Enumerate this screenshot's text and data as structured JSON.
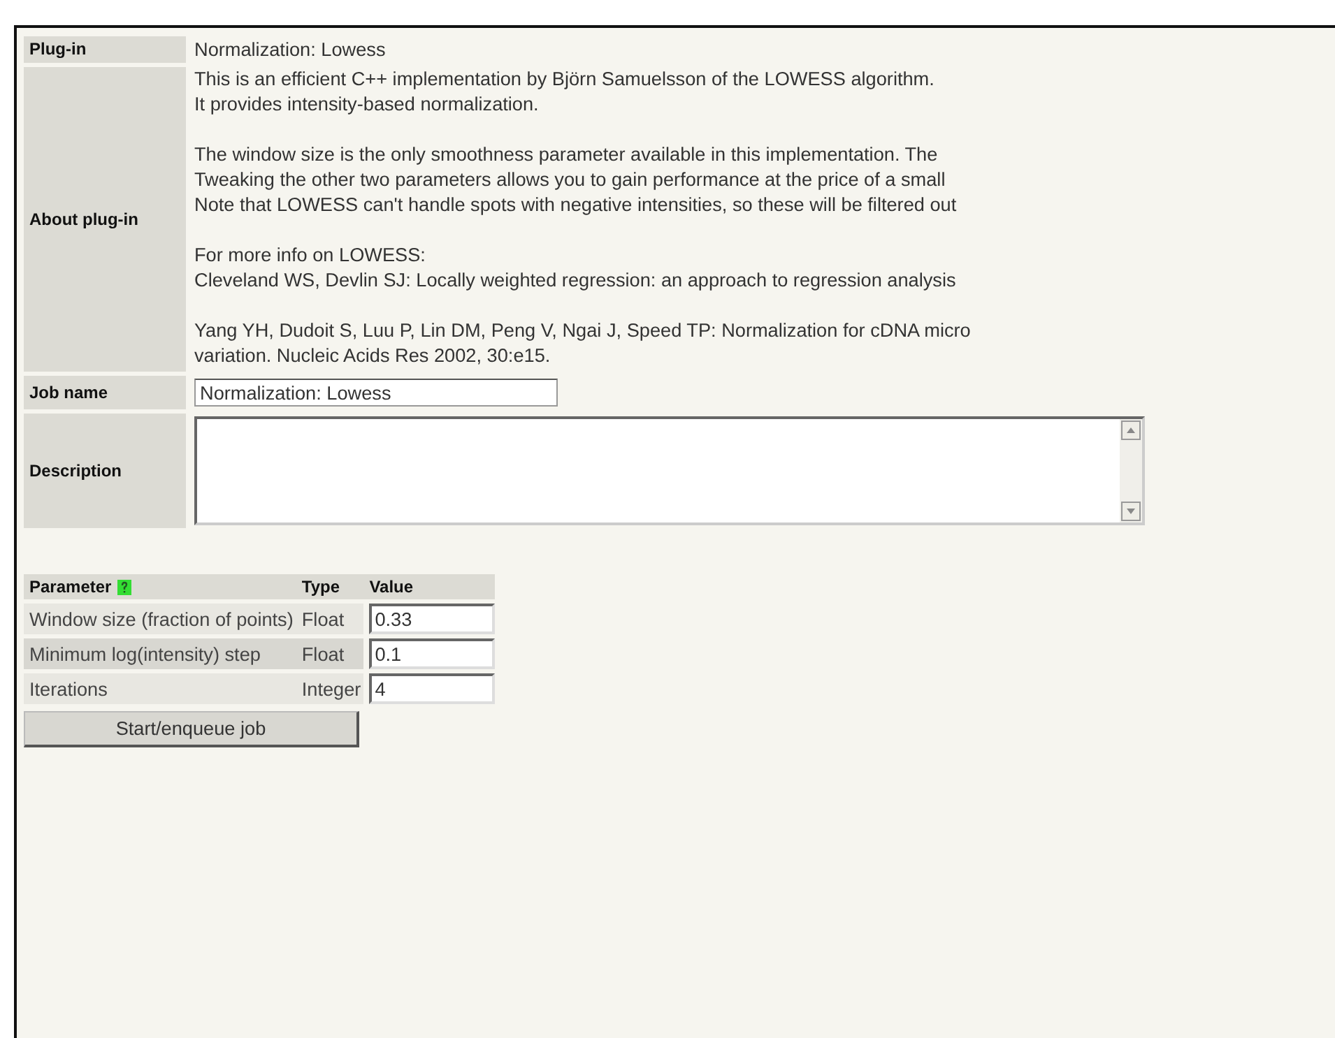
{
  "plugin": {
    "label": "Plug-in",
    "value": "Normalization: Lowess"
  },
  "about": {
    "label": "About plug-in",
    "paragraphs": [
      [
        "This is an efficient C++ implementation by Björn Samuelsson of the LOWESS algorithm.",
        "It provides intensity-based normalization."
      ],
      [
        "The window size is the only smoothness parameter available in this implementation. The",
        "Tweaking the other two parameters allows you to gain performance at the price of a small",
        "Note that LOWESS can't handle spots with negative intensities, so these will be filtered out"
      ],
      [
        "For more info on LOWESS:",
        "Cleveland WS, Devlin SJ: Locally weighted regression: an approach to regression analysis"
      ],
      [
        "Yang YH, Dudoit S, Luu P, Lin DM, Peng V, Ngai J, Speed TP: Normalization for cDNA micro",
        "variation. Nucleic Acids Res 2002, 30:e15."
      ]
    ]
  },
  "job_name": {
    "label": "Job name",
    "value": "Normalization: Lowess"
  },
  "description": {
    "label": "Description"
  },
  "parameters": {
    "columns": [
      "Parameter",
      "Type",
      "Value"
    ],
    "rows": [
      {
        "name": "Window size (fraction of points)",
        "type": "Float",
        "value": "0.33"
      },
      {
        "name": "Minimum log(intensity) step",
        "type": "Float",
        "value": "0.1"
      },
      {
        "name": "Iterations",
        "type": "Integer",
        "value": "4"
      }
    ]
  },
  "button": "Start/enqueue job"
}
